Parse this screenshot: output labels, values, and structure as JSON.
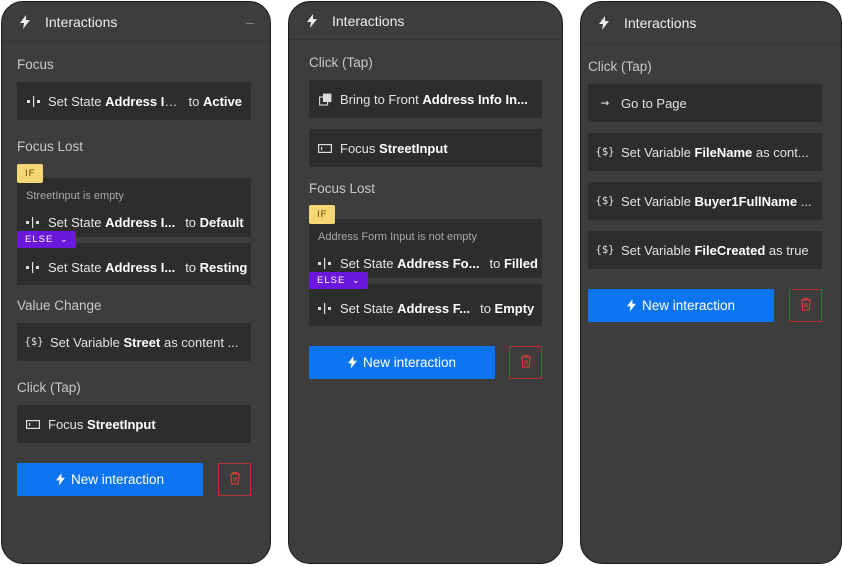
{
  "panels": [
    {
      "title": "Interactions",
      "collapse": "–",
      "sections": {
        "focus": "Focus",
        "focus_lost": "Focus Lost",
        "value_change": "Value Change",
        "click": "Click (Tap)"
      },
      "actions": {
        "focus_set_state": {
          "prefix": "Set State",
          "target": "Address In...",
          "to": "to",
          "state": "Active"
        },
        "if_label": "IF",
        "else_label": "ELSE",
        "if_condition": "StreetInput is empty",
        "if_set_state": {
          "prefix": "Set State",
          "target": "Address I...",
          "to": "to",
          "state": "Default"
        },
        "else_set_state": {
          "prefix": "Set State",
          "target": "Address I...",
          "to": "to",
          "state": "Resting"
        },
        "set_variable": {
          "prefix": "Set Variable",
          "name": "Street",
          "rest": "as content ..."
        },
        "click_focus": {
          "prefix": "Focus",
          "target": "StreetInput"
        }
      },
      "new_interaction": "New interaction"
    },
    {
      "title": "Interactions",
      "sections": {
        "click": "Click (Tap)",
        "focus_lost": "Focus Lost"
      },
      "actions": {
        "bring_to_front": {
          "prefix": "Bring to Front",
          "target": "Address Info In..."
        },
        "focus": {
          "prefix": "Focus",
          "target": "StreetInput"
        },
        "if_label": "IF",
        "else_label": "ELSE",
        "if_condition": "Address Form Input is not empty",
        "if_set_state": {
          "prefix": "Set State",
          "target": "Address Fo...",
          "to": "to",
          "state": "Filled"
        },
        "else_set_state": {
          "prefix": "Set State",
          "target": "Address F...",
          "to": "to",
          "state": "Empty"
        }
      },
      "new_interaction": "New interaction"
    },
    {
      "title": "Interactions",
      "sections": {
        "click": "Click (Tap)"
      },
      "actions": {
        "go_to_page": {
          "arrow": "→",
          "label": "Go to Page"
        },
        "var1": {
          "prefix": "Set Variable",
          "name": "FileName",
          "rest": "as cont..."
        },
        "var2": {
          "prefix": "Set Variable",
          "name": "Buyer1FullName",
          "rest": "..."
        },
        "var3": {
          "prefix": "Set Variable",
          "name": "FileCreated",
          "rest": "as true"
        }
      },
      "new_interaction": "New interaction"
    }
  ],
  "icons": {
    "bolt": "lightning-bolt-icon",
    "set_state": "set-state-icon",
    "variable": "{$}",
    "focus": "input-field-icon",
    "bring_front": "bring-to-front-icon",
    "trash": "trash-icon",
    "chevron": "⌄"
  },
  "colors": {
    "panel_bg": "#3d3d3d",
    "card_bg": "#2d2d2d",
    "primary": "#0b74ee",
    "if_badge": "#f7d774",
    "else_badge": "#6b17dc",
    "danger": "#b53030"
  }
}
